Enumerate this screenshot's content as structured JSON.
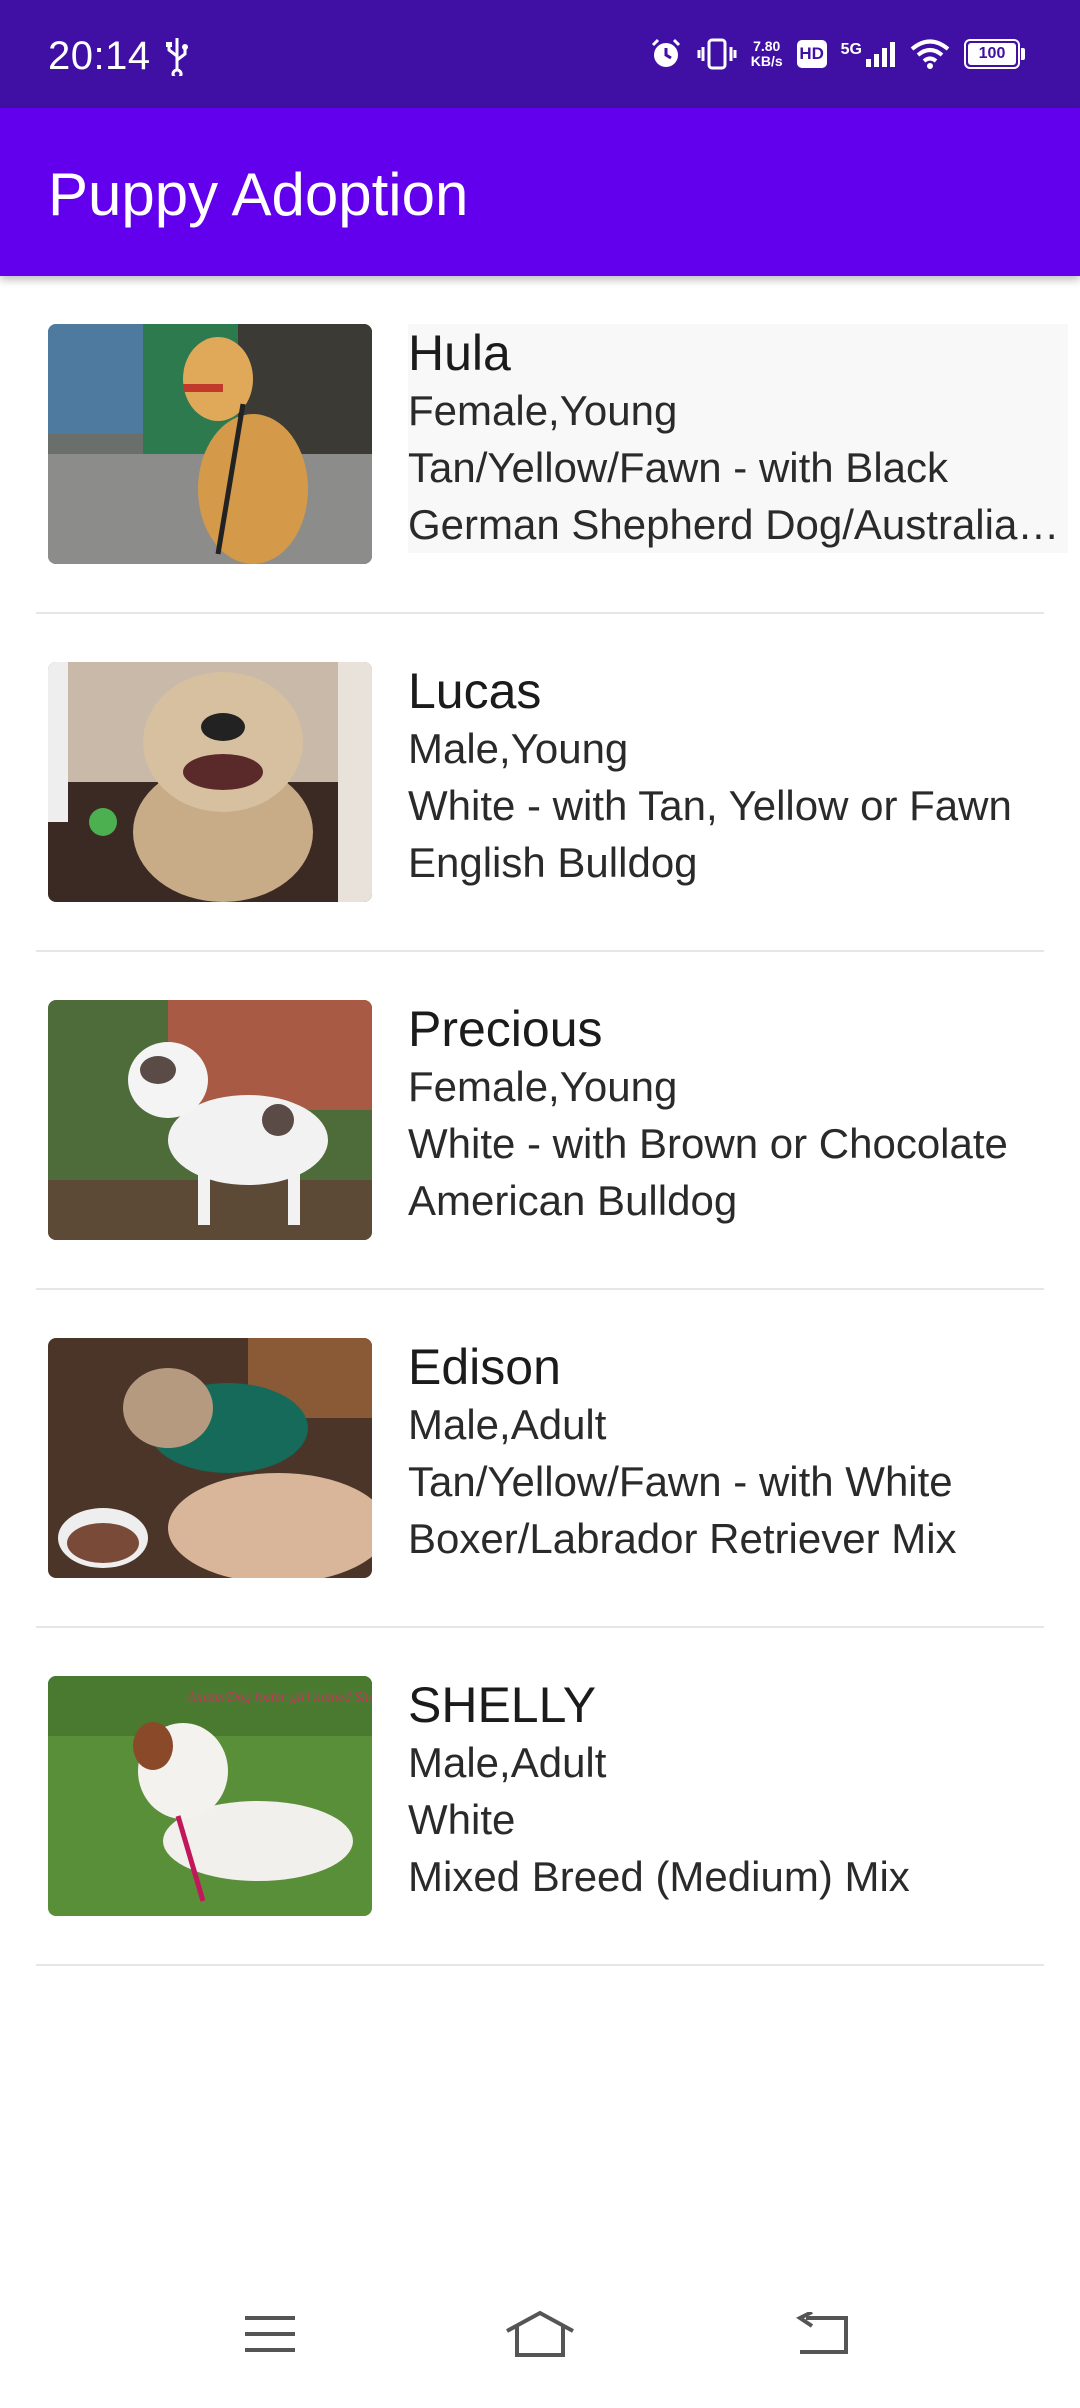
{
  "status_bar": {
    "time": "20:14",
    "net_speed_value": "7.80",
    "net_speed_unit": "KB/s",
    "hd_label": "HD",
    "network_label": "5G",
    "battery_level": "100"
  },
  "app_bar": {
    "title": "Puppy Adoption"
  },
  "pets": [
    {
      "name": "Hula",
      "gender_age": "Female,Young",
      "color": "Tan/Yellow/Fawn - with Black",
      "breed": "German Shepherd Dog/Australian Shepherd Mix"
    },
    {
      "name": "Lucas",
      "gender_age": "Male,Young",
      "color": "White - with Tan, Yellow or Fawn",
      "breed": "English Bulldog"
    },
    {
      "name": "Precious",
      "gender_age": "Female,Young",
      "color": "White - with Brown or Chocolate",
      "breed": "American Bulldog"
    },
    {
      "name": "Edison",
      "gender_age": "Male,Adult",
      "color": "Tan/Yellow/Fawn - with White",
      "breed": "Boxer/Labrador Retriever Mix"
    },
    {
      "name": "SHELLY",
      "gender_age": "Male,Adult",
      "color": "White",
      "breed": "Mixed Breed (Medium) Mix",
      "photo_caption": "AmsterDog foster girl named Shelly"
    }
  ],
  "nav_bar": {
    "icons": [
      "menu-icon",
      "home-icon",
      "back-icon"
    ]
  }
}
